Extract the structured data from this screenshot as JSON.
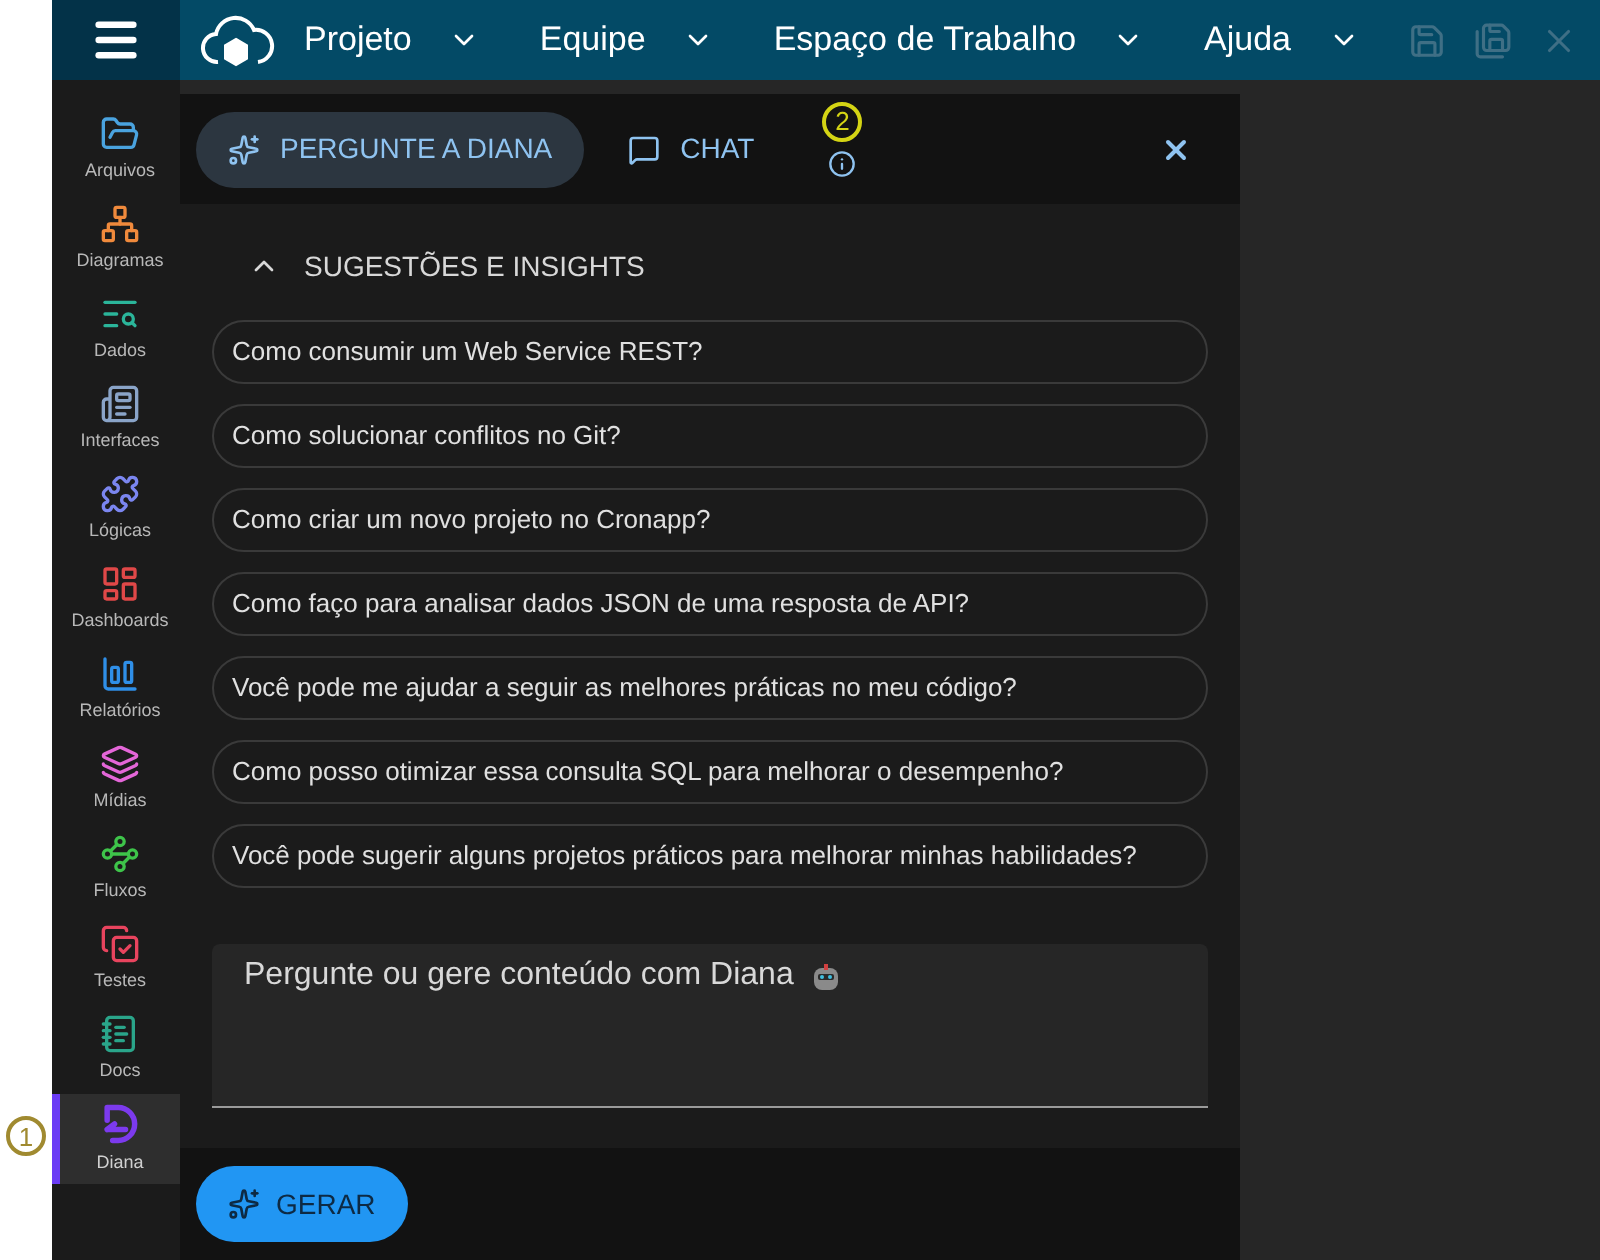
{
  "menu": [
    {
      "label": "Projeto"
    },
    {
      "label": "Equipe"
    },
    {
      "label": "Espaço de Trabalho"
    },
    {
      "label": "Ajuda"
    }
  ],
  "toolbar": [
    {
      "kind": "save",
      "disabled": true
    },
    {
      "kind": "save-all",
      "disabled": true
    },
    {
      "kind": "close",
      "disabled": true
    }
  ],
  "sidebar": {
    "items": [
      {
        "label": "Arquivos",
        "color": "#4aa3df",
        "selected": false
      },
      {
        "label": "Diagramas",
        "color": "#f08a3c",
        "selected": false
      },
      {
        "label": "Dados",
        "color": "#2bb59a",
        "selected": false
      },
      {
        "label": "Interfaces",
        "color": "#8aa4c8",
        "selected": false
      },
      {
        "label": "Lógicas",
        "color": "#7b86f0",
        "selected": false
      },
      {
        "label": "Dashboards",
        "color": "#e04848",
        "selected": false
      },
      {
        "label": "Relatórios",
        "color": "#2f8fe8",
        "selected": false
      },
      {
        "label": "Mídias",
        "color": "#e466d8",
        "selected": false
      },
      {
        "label": "Fluxos",
        "color": "#3ec44a",
        "selected": false
      },
      {
        "label": "Testes",
        "color": "#e8445e",
        "selected": false
      },
      {
        "label": "Docs",
        "color": "#2aa58a",
        "selected": false
      },
      {
        "label": "Diana",
        "color": "#7c3aed",
        "selected": true
      }
    ]
  },
  "callouts": [
    {
      "label": "1"
    },
    {
      "label": "2"
    }
  ],
  "panel": {
    "tabs": [
      {
        "label": "PERGUNTE A DIANA",
        "selected": true
      },
      {
        "label": "CHAT",
        "selected": false
      }
    ],
    "section": {
      "title": "SUGESTÕES E INSIGHTS",
      "expanded": true
    },
    "suggestions": [
      "Como consumir um Web Service REST?",
      "Como solucionar conflitos no Git?",
      "Como criar um novo projeto no Cronapp?",
      "Como faço para analisar dados JSON de uma resposta de API?",
      "Você pode me ajudar a seguir as melhores práticas no meu código?",
      "Como posso otimizar essa consulta SQL para melhorar o desempenho?",
      "Você pode sugerir alguns projetos práticos para melhorar minhas habilidades?"
    ],
    "prompt": {
      "placeholder": "Pergunte ou gere conteúdo com Diana"
    },
    "generate_button": "GERAR"
  }
}
